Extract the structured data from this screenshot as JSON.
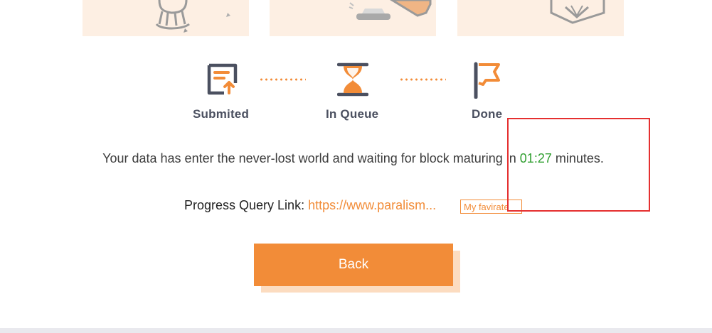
{
  "steps": [
    {
      "label": "Submited",
      "icon": "document-upload-icon"
    },
    {
      "label": "In Queue",
      "icon": "hourglass-icon"
    },
    {
      "label": "Done",
      "icon": "flag-icon"
    }
  ],
  "message": {
    "before": "Your data has enter the never-lost world and waiting for block maturing in ",
    "timer": "01:27",
    "after": " minutes."
  },
  "progress": {
    "label": "Progress Query Link: ",
    "link": "https://www.paralism...",
    "favorite_label": "My favirate"
  },
  "back_label": "Back",
  "colors": {
    "accent": "#f28c38",
    "accent_light": "#fdefe3",
    "timer_green": "#2f9e2f",
    "icon_dark": "#4b5060",
    "annotation_red": "#e53030"
  }
}
